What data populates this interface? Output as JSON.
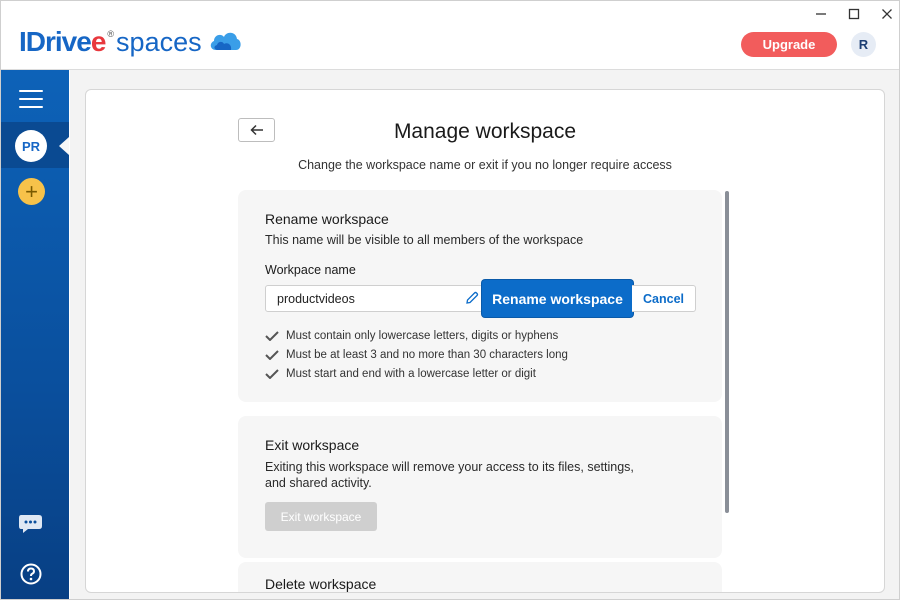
{
  "app": {
    "logo_brand": "IDrive",
    "logo_e": "e",
    "logo_reg": "®",
    "logo_product": "spaces"
  },
  "header": {
    "upgrade_label": "Upgrade",
    "user_initial": "R"
  },
  "window_controls": {
    "minimize": "—",
    "maximize": "☐",
    "close": "✕"
  },
  "sidebar": {
    "active_workspace_initials": "PR",
    "add_workspace": "+"
  },
  "main": {
    "title": "Manage workspace",
    "subtitle": "Change the workspace name or exit if you no longer require access",
    "rename": {
      "title": "Rename workspace",
      "description": "This name will be visible to all members of the workspace",
      "field_label": "Workpace name",
      "field_value": "productvideos",
      "rename_button": "Rename workspace",
      "cancel_button": "Cancel",
      "rules": [
        "Must contain only lowercase letters, digits or hyphens",
        "Must be at least 3 and no more than 30 characters long",
        "Must start and end with a lowercase letter or digit"
      ]
    },
    "exit": {
      "title": "Exit workspace",
      "description_line1": "Exiting this workspace will remove your access to its files, settings,",
      "description_line2": "and shared activity.",
      "button": "Exit workspace"
    },
    "delete": {
      "title": "Delete workspace"
    }
  },
  "colors": {
    "brand_blue": "#1666c5",
    "primary_button": "#0c6cc9",
    "upgrade": "#f25c5c",
    "add_workspace": "#f7c24a",
    "disabled_button": "#cfcfcf"
  }
}
